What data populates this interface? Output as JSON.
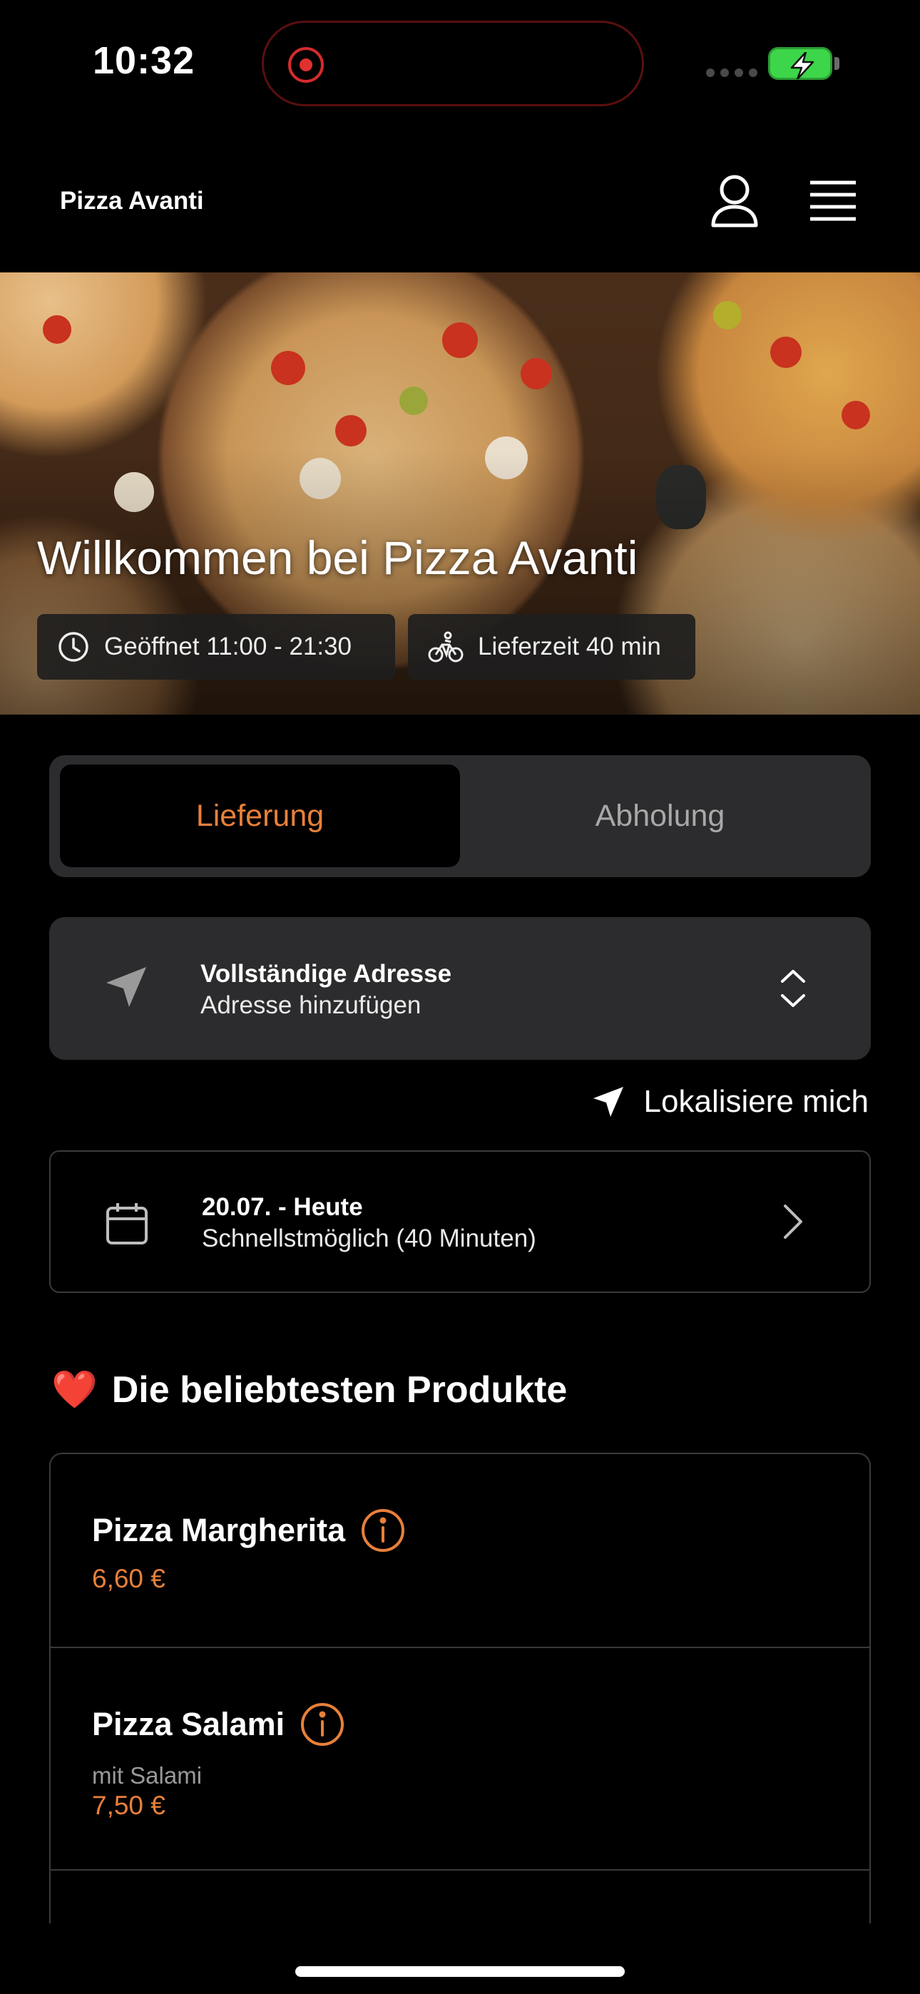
{
  "status_bar": {
    "time": "10:32"
  },
  "header": {
    "brand": "Pizza Avanti",
    "user_icon": "user-icon",
    "menu_icon": "hamburger-menu-icon"
  },
  "hero": {
    "title": "Willkommen bei Pizza Avanti",
    "open_hours": "Geöffnet 11:00 - 21:30",
    "delivery_time": "Lieferzeit 40 min"
  },
  "segment": {
    "active": "Lieferung",
    "inactive": "Abholung"
  },
  "address": {
    "title": "Vollständige Adresse",
    "subtitle": "Adresse hinzufügen"
  },
  "locate": {
    "label": "Lokalisiere mich"
  },
  "date": {
    "title": "20.07. - Heute",
    "subtitle": "Schnellstmöglich (40 Minuten)"
  },
  "popular": {
    "emoji": "❤️",
    "title": "Die beliebtesten Produkte",
    "products": [
      {
        "name": "Pizza Margherita",
        "description": "",
        "price": "6,60 €"
      },
      {
        "name": "Pizza Salami",
        "description": "mit Salami",
        "price": "7,50 €"
      }
    ]
  },
  "colors": {
    "accent": "#e8803a",
    "background": "#000000",
    "card": "#2c2c2e"
  }
}
